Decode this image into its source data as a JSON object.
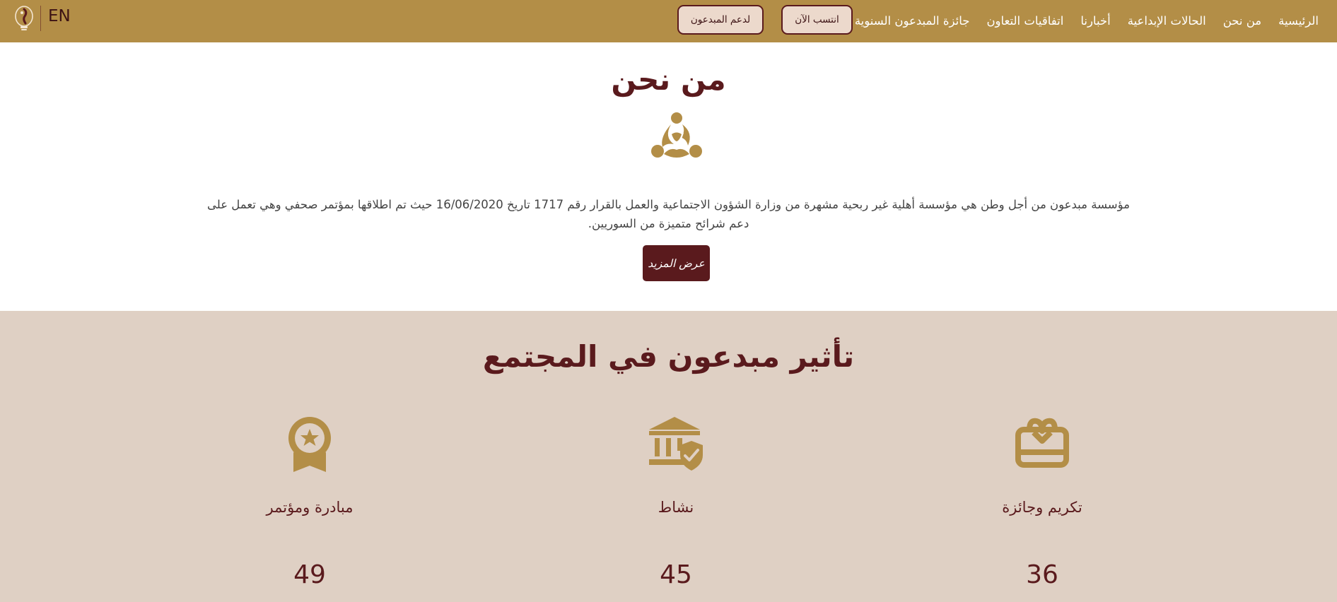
{
  "navbar": {
    "lang_toggle": "EN",
    "support_button": "لدعم المبدعون",
    "join_button": "انتسب الآن",
    "links": [
      "الرئيسية",
      "من نحن",
      "الحالات الإبداعية",
      "أخبارنا",
      "اتفاقيات التعاون",
      "جائزة المبدعون السنوية"
    ],
    "brand_color": "#b38e47"
  },
  "about": {
    "title": "من نحن",
    "text": "مؤسسة مبدعون من أجل وطن هي مؤسسة أهلية غير ربحية مشهرة من وزارة الشؤون الاجتماعية والعمل بالقرار رقم 1717 تاريخ 16/06/2020 حيث تم اطلاقها بمؤتمر صحفي وهي تعمل على دعم شرائح متميزة من السوريين.",
    "more_button": "عرض المزيد"
  },
  "impact": {
    "title": "تأثير مبدعون في المجتمع",
    "background_color": "#dfd0c4",
    "stats": [
      {
        "icon": "award-ribbon-icon",
        "label": "مبادرة ومؤتمر",
        "value": "49"
      },
      {
        "icon": "institution-shield-icon",
        "label": "نشاط",
        "value": "45"
      },
      {
        "icon": "gift-card-icon",
        "label": "تكريم وجائزة",
        "value": "36"
      }
    ]
  },
  "colors": {
    "primary_dark": "#5a1a1d",
    "gold": "#b38e47"
  }
}
